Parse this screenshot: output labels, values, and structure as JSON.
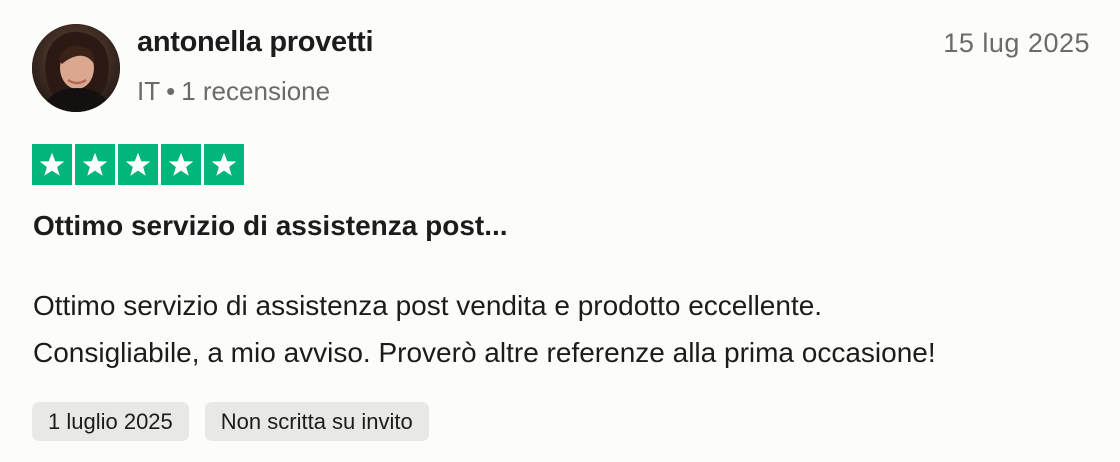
{
  "reviewer": {
    "name": "antonella provetti",
    "country": "IT",
    "separator": "•",
    "review_count": "1 recensione"
  },
  "review": {
    "date": "15 lug 2025",
    "rating": 5,
    "rating_max": 5,
    "star_color": "#00b67a",
    "title": "Ottimo servizio di assistenza post...",
    "body_line1": "Ottimo servizio di assistenza post vendita e prodotto eccellente.",
    "body_line2": "Consigliabile, a mio avviso. Proverò altre referenze alla prima occasione!"
  },
  "tags": {
    "experience_date": "1 luglio 2025",
    "invite_status": "Non scritta su invito"
  }
}
